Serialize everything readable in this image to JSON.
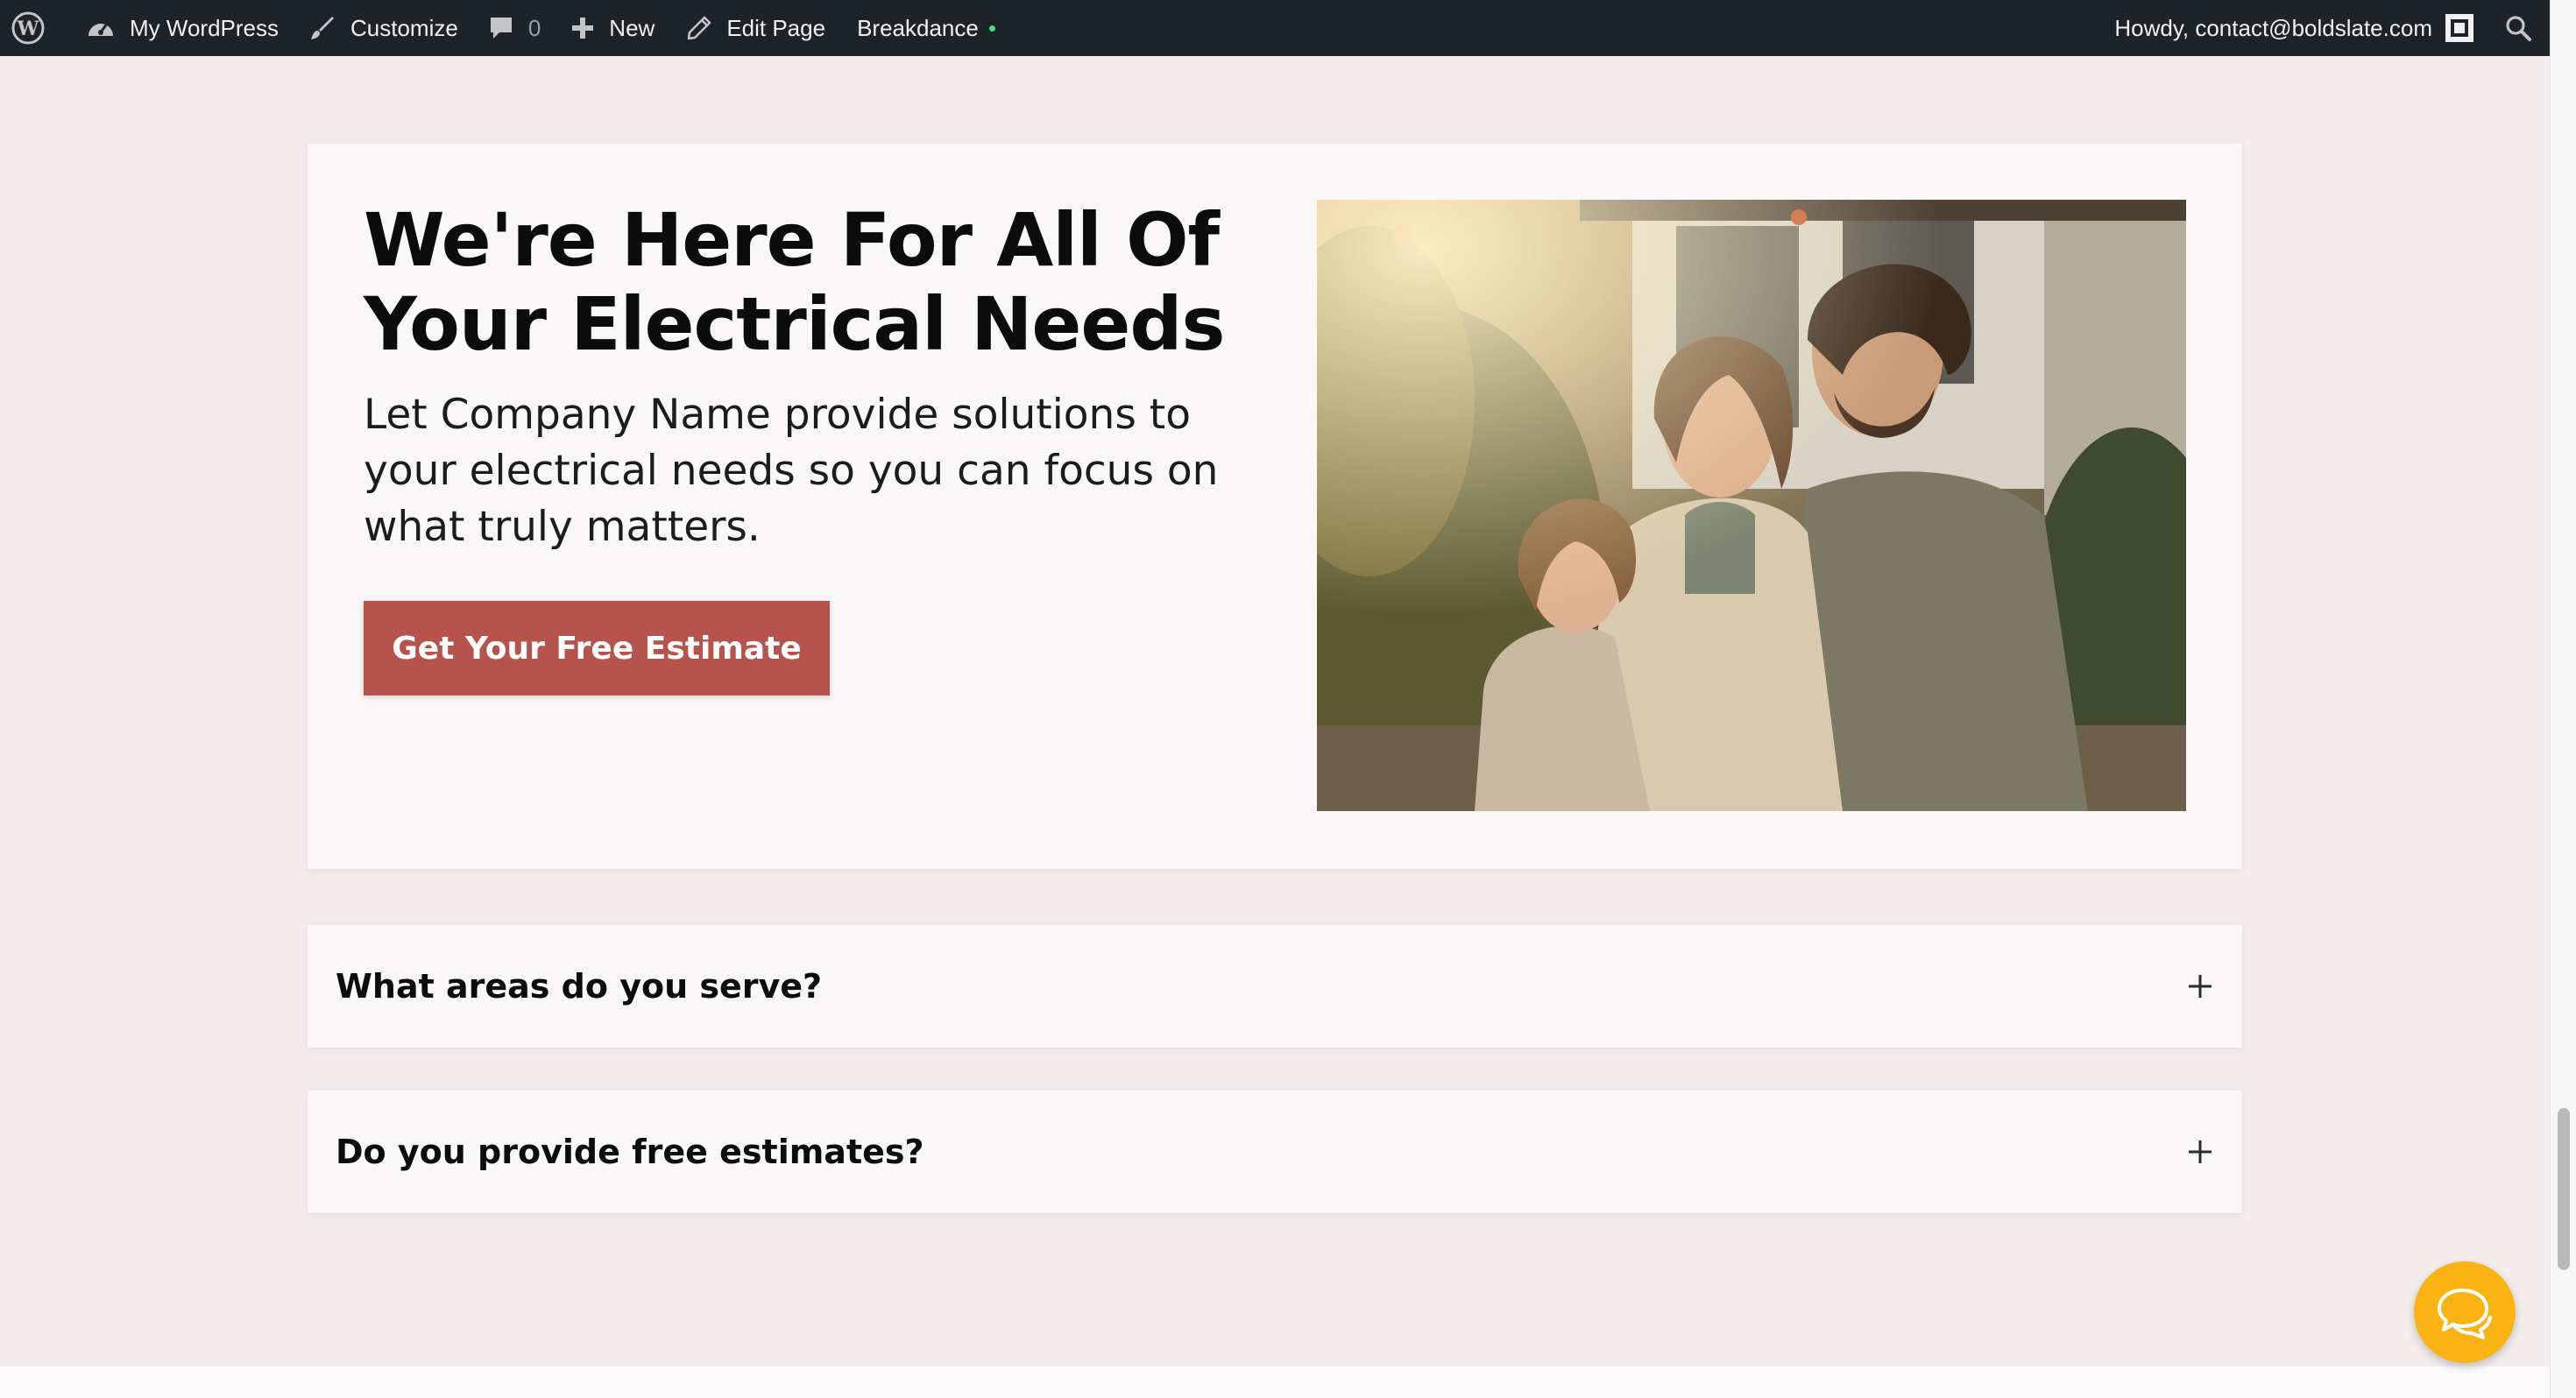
{
  "admin_bar": {
    "site_name": "My WordPress",
    "customize": "Customize",
    "comments_count": "0",
    "new": "New",
    "edit_page": "Edit Page",
    "breakdance": "Breakdance",
    "howdy": "Howdy, contact@boldslate.com",
    "icons": [
      "wordpress-logo-icon",
      "dashboard-icon",
      "brush-icon",
      "comment-icon",
      "plus-icon",
      "pencil-icon",
      "search-icon"
    ]
  },
  "hero": {
    "title": "We're Here For All Of Your Electrical Needs",
    "text": "Let Company Name provide solutions to your electrical needs so you can focus on what truly matters.",
    "cta_label": "Get Your Free Estimate"
  },
  "faq": [
    {
      "question": "What areas do you serve?"
    },
    {
      "question": "Do you provide free estimates?"
    }
  ],
  "colors": {
    "admin_bar_bg": "#1d2327",
    "page_bg": "#f2ecec",
    "card_bg": "#f9f7f7",
    "cta_bg": "#b5534c",
    "chat_button": "#fbb313"
  }
}
